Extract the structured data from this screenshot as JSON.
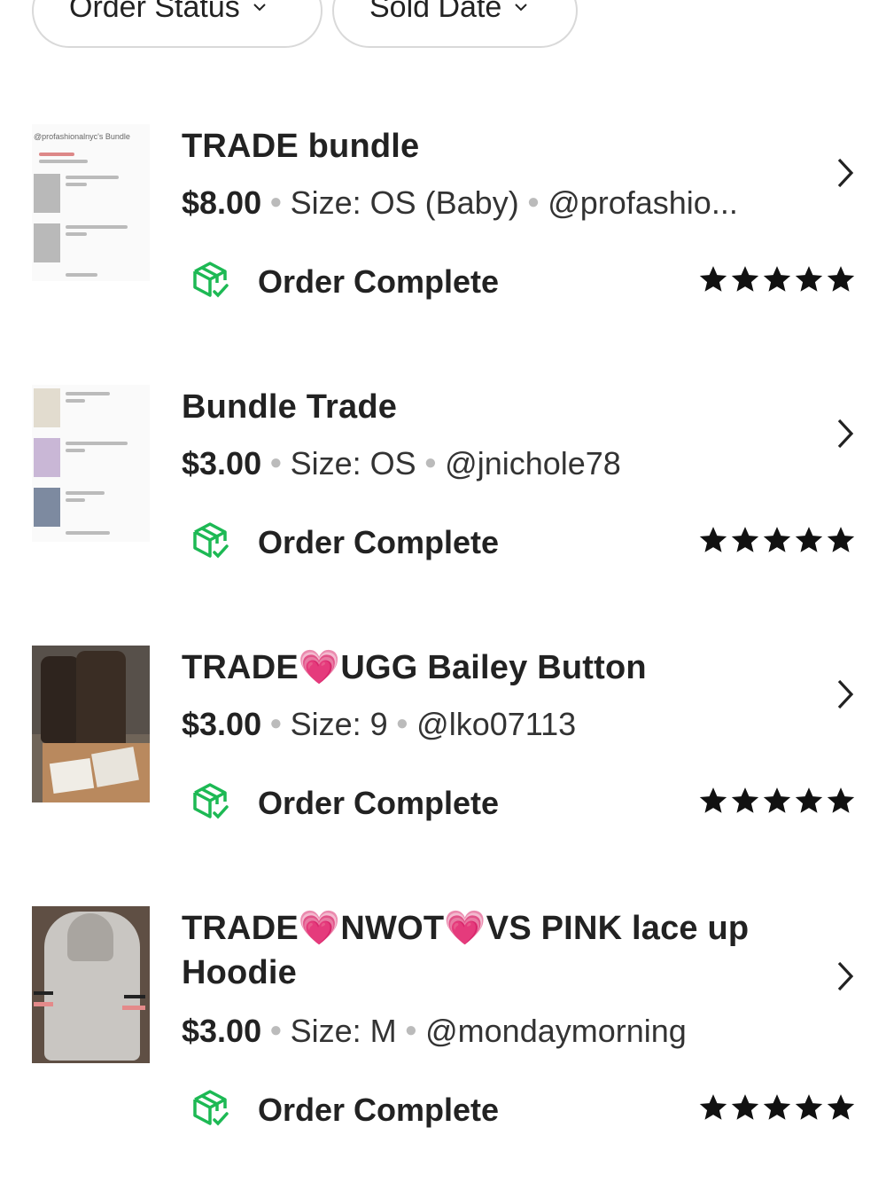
{
  "filters": [
    {
      "label": "Order Status"
    },
    {
      "label": "Sold Date"
    }
  ],
  "orders": [
    {
      "title": "TRADE bundle",
      "price": "$8.00",
      "size": "Size: OS (Baby)",
      "seller": "@profashio...",
      "status": "Order Complete",
      "rating": 5,
      "thumb_header": "@profashionalnyc's Bundle"
    },
    {
      "title": "Bundle Trade",
      "price": "$3.00",
      "size": "Size: OS",
      "seller": "@jnichole78",
      "status": "Order Complete",
      "rating": 5
    },
    {
      "title": "TRADE💗UGG Bailey Button",
      "price": "$3.00",
      "size": "Size: 9",
      "seller": "@lko07113",
      "status": "Order Complete",
      "rating": 5
    },
    {
      "title": "TRADE💗NWOT💗VS PINK lace up Hoodie",
      "price": "$3.00",
      "size": "Size: M",
      "seller": "@mondaymorning",
      "status": "Order Complete",
      "rating": 5
    }
  ],
  "colors": {
    "status_icon": "#1db954",
    "star": "#111111",
    "pill_border": "#d9d9d9"
  },
  "icons": {
    "chevron": "chevron-down-icon",
    "arrow": "chevron-right-icon",
    "status": "box-check-icon",
    "star": "star-icon"
  }
}
